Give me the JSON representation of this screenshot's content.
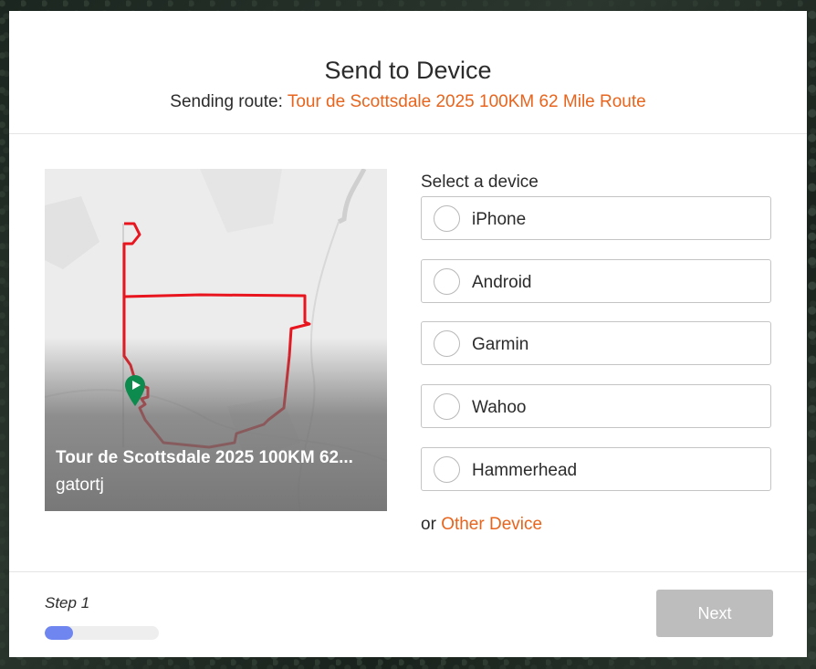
{
  "modal": {
    "title": "Send to Device",
    "subtitle_prefix": "Sending route: ",
    "route_name": "Tour de Scottsdale 2025 100KM 62 Mile Route"
  },
  "route_card": {
    "title": "Tour de Scottsdale 2025 100KM 62...",
    "owner": "gatortj",
    "route_color": "#e8141e",
    "start_pin_color": "#0d8a4d"
  },
  "devices": {
    "label": "Select a device",
    "options": [
      {
        "label": "iPhone",
        "selected": false
      },
      {
        "label": "Android",
        "selected": false
      },
      {
        "label": "Garmin",
        "selected": false
      },
      {
        "label": "Wahoo",
        "selected": false
      },
      {
        "label": "Hammerhead",
        "selected": false
      }
    ],
    "other_prefix": "or ",
    "other_link": "Other Device"
  },
  "footer": {
    "step_label": "Step 1",
    "progress": 0.25,
    "progress_color": "#6f86f0",
    "next_label": "Next",
    "next_enabled": false
  },
  "colors": {
    "accent": "#e8641c"
  }
}
